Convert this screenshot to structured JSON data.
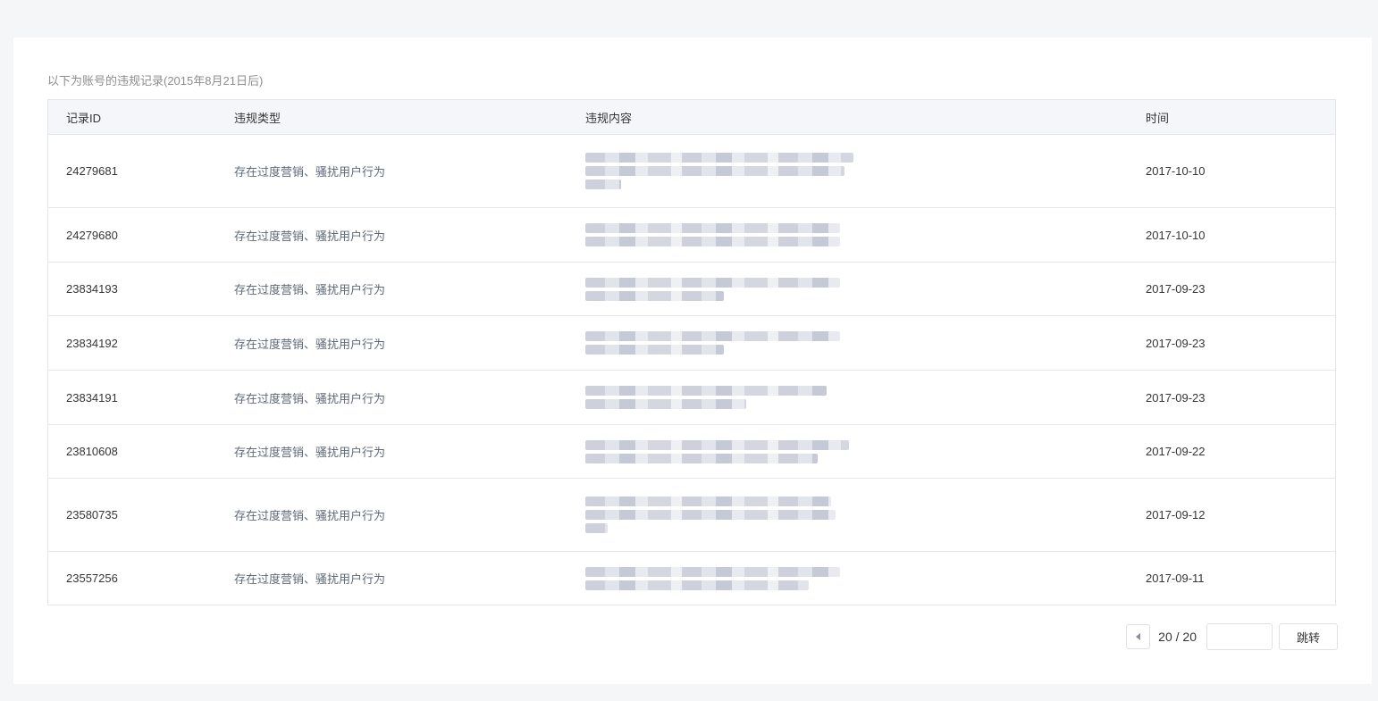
{
  "caption": "以下为账号的违规记录(2015年8月21日后)",
  "table": {
    "headers": [
      "记录ID",
      "违规类型",
      "违规内容",
      "时间"
    ],
    "rows": [
      {
        "id": "24279681",
        "type": "存在过度营销、骚扰用户行为",
        "time": "2017-10-10"
      },
      {
        "id": "24279680",
        "type": "存在过度营销、骚扰用户行为",
        "time": "2017-10-10"
      },
      {
        "id": "23834193",
        "type": "存在过度营销、骚扰用户行为",
        "time": "2017-09-23"
      },
      {
        "id": "23834192",
        "type": "存在过度营销、骚扰用户行为",
        "time": "2017-09-23"
      },
      {
        "id": "23834191",
        "type": "存在过度营销、骚扰用户行为",
        "time": "2017-09-23"
      },
      {
        "id": "23810608",
        "type": "存在过度营销、骚扰用户行为",
        "time": "2017-09-22"
      },
      {
        "id": "23580735",
        "type": "存在过度营销、骚扰用户行为",
        "time": "2017-09-12"
      },
      {
        "id": "23557256",
        "type": "存在过度营销、骚扰用户行为",
        "time": "2017-09-11"
      }
    ]
  },
  "pagination": {
    "indicator": "20 / 20",
    "jump_input_value": "",
    "jump_button_label": "跳转",
    "prev_icon": "caret-left-icon"
  }
}
